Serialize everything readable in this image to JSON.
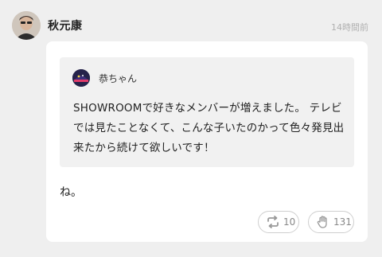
{
  "post": {
    "author_name": "秋元康",
    "timestamp": "14時間前",
    "avatar": "author-avatar-photo",
    "quote": {
      "author_name": "恭ちゃん",
      "avatar": "cap-avatar-photo",
      "text": "SHOWROOMで好きなメンバーが増えました。 テレビでは見たことなくて、こんな子いたのかって色々発見出来たから続けて欲しいです！"
    },
    "reply_text": "ね。",
    "actions": {
      "repost_icon": "repost-icon",
      "repost_count": "10",
      "clap_icon": "clap-hand-icon",
      "clap_count": "131"
    }
  }
}
